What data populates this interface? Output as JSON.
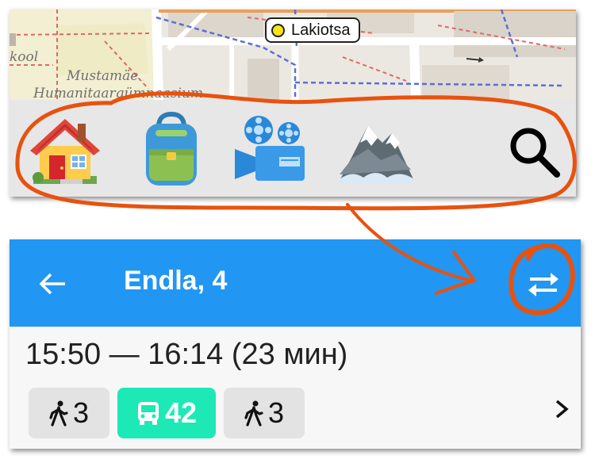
{
  "map": {
    "labels": {
      "kool": "kool",
      "mustamae": "Mustamäe",
      "gymnasium": "Humanitaargümnaasium"
    },
    "stop_name": "Lakiotsa"
  },
  "categories": [
    {
      "name": "home",
      "icon": "house-icon"
    },
    {
      "name": "school",
      "icon": "backpack-icon"
    },
    {
      "name": "cinema",
      "icon": "movie-camera-icon"
    },
    {
      "name": "mountains",
      "icon": "snow-mountain-icon"
    },
    {
      "name": "search",
      "icon": "search-icon"
    }
  ],
  "route": {
    "title": "Endla, 4",
    "time_summary": "15:50 — 16:14 (23 мин)",
    "legs": {
      "walk_start": "3",
      "bus_line": "42",
      "walk_end": "3"
    }
  },
  "colors": {
    "header": "#2196f3",
    "bus_leg": "#1de9b6",
    "annotation": "#e8520e",
    "stop_dot": "#f7e51a"
  }
}
